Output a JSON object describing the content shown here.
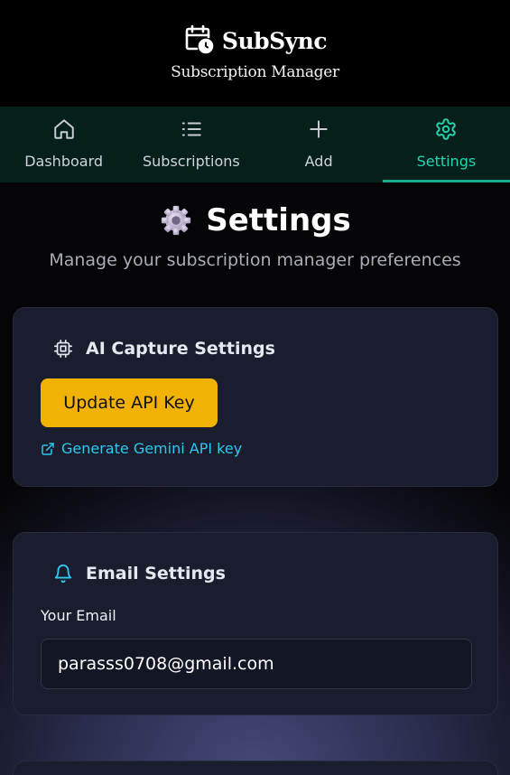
{
  "app": {
    "name": "SubSync",
    "subtitle": "Subscription Manager"
  },
  "nav": {
    "tabs": [
      {
        "label": "Dashboard",
        "icon": "home-icon"
      },
      {
        "label": "Subscriptions",
        "icon": "list-icon"
      },
      {
        "label": "Add",
        "icon": "plus-icon"
      },
      {
        "label": "Settings",
        "icon": "gear-icon",
        "active": true
      }
    ]
  },
  "page": {
    "title": "Settings",
    "subtitle": "Manage your subscription manager preferences"
  },
  "ai_settings": {
    "title": "AI Capture Settings",
    "icon": "cpu-chip-icon",
    "button_label": "Update API Key",
    "link_label": "Generate Gemini API key",
    "link_icon": "external-link-icon"
  },
  "email_settings": {
    "title": "Email Settings",
    "icon": "bell-icon",
    "field_label": "Your Email",
    "email_value": "parasss0708@gmail.com"
  },
  "colors": {
    "accent": "#1ed6b0",
    "button": "#f2b203",
    "link": "#2ec7ee",
    "card": "#1a1d2e"
  }
}
